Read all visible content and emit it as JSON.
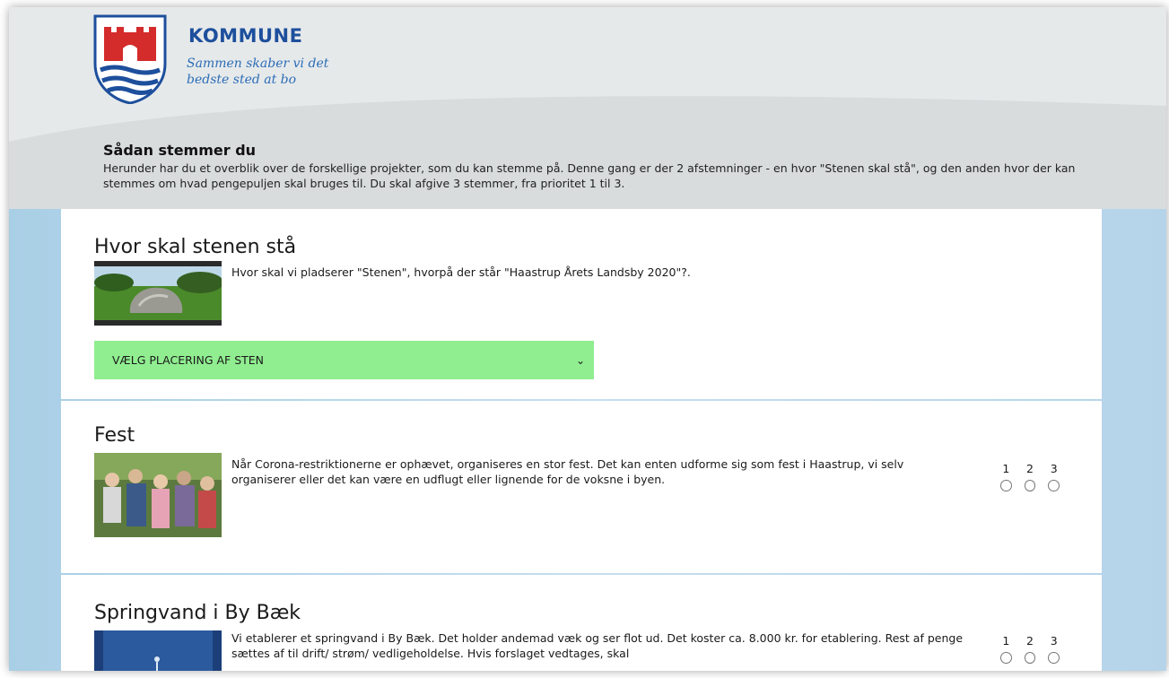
{
  "header": {
    "logo_name": "KOMMUNE",
    "tagline_line1": "Sammen skaber vi det",
    "tagline_line2": "bedste sted at bo"
  },
  "intro": {
    "title": "Sådan stemmer du",
    "text": "Herunder har du et overblik over de forskellige projekter, som du kan stemme på. Denne gang er der 2 afstemninger - en hvor \"Stenen skal stå\", og den anden hvor der kan stemmes om hvad pengepuljen skal bruges til. Du skal afgive 3 stemmer, fra prioritet 1 til 3."
  },
  "projects": [
    {
      "title": "Hvor skal stenen stå",
      "description": "Hvor skal vi pladserer \"Stenen\", hvorpå der står \"Haastrup Årets Landsby 2020\"?.",
      "select_value": "VÆLG PLACERING AF STEN"
    },
    {
      "title": "Fest",
      "description": "Når Corona-restriktionerne er ophævet, organiseres en stor fest. Det kan enten udforme sig som fest i Haastrup, vi selv organiserer eller det kan være en udflugt eller lignende for de voksne i byen.",
      "priority_labels": [
        "1",
        "2",
        "3"
      ]
    },
    {
      "title": "Springvand i By Bæk",
      "description": "Vi etablerer et springvand i By Bæk. Det holder andemad væk og ser flot ud. Det koster ca. 8.000 kr. for etablering. Rest af penge sættes af til drift/ strøm/ vedligeholdelse. Hvis forslaget vedtages, skal",
      "priority_labels": [
        "1",
        "2",
        "3"
      ]
    }
  ],
  "colors": {
    "header_bg": "#e6e9ea",
    "page_bg_blue": "#b5d4ea",
    "select_bg": "#90ee90",
    "logo_blue": "#1d4f9c",
    "shield_red": "#d42b2b"
  }
}
